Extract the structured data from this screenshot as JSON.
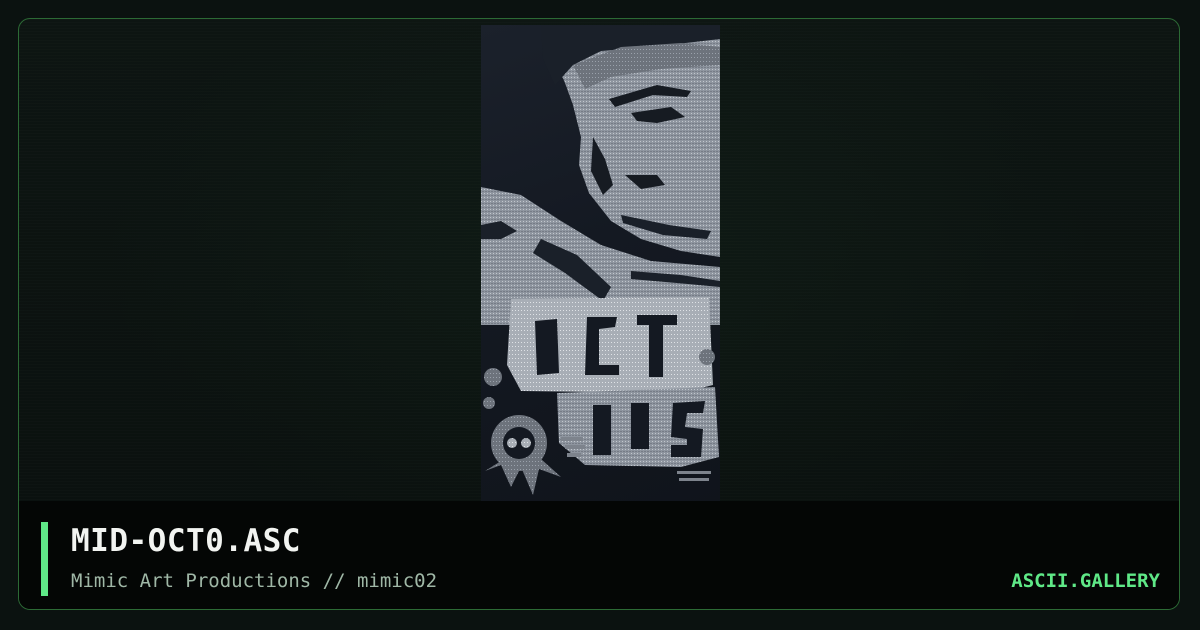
{
  "artwork": {
    "title": "MID-OCT0.ASC",
    "author_line": "Mimic Art Productions // mimic02",
    "image_icon": "ascii-art-image"
  },
  "brand": {
    "label": "ASCII.GALLERY"
  },
  "colors": {
    "accent": "#5fe887",
    "border": "#2c6a35",
    "background": "#0b1210",
    "footer": "#040605",
    "title": "#f2f4f1",
    "subtitle": "#9fb7a6",
    "art_light": "#9aa1ab",
    "art_dark": "#141922"
  }
}
